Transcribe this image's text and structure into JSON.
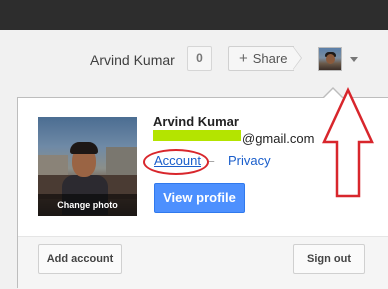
{
  "header": {
    "username": "Arvind Kumar",
    "notification_count": "0",
    "share_label": "Share"
  },
  "profile": {
    "name": "Arvind Kumar",
    "email_domain": "@gmail.com",
    "change_photo_label": "Change photo",
    "account_link": "Account",
    "separator": "–",
    "privacy_link": "Privacy",
    "view_profile_label": "View profile"
  },
  "footer": {
    "add_account_label": "Add account",
    "sign_out_label": "Sign out"
  },
  "colors": {
    "annotation_red": "#d8262c",
    "link_blue": "#1a5ecb",
    "button_blue": "#4d90fe",
    "email_highlight": "#b4e400"
  }
}
